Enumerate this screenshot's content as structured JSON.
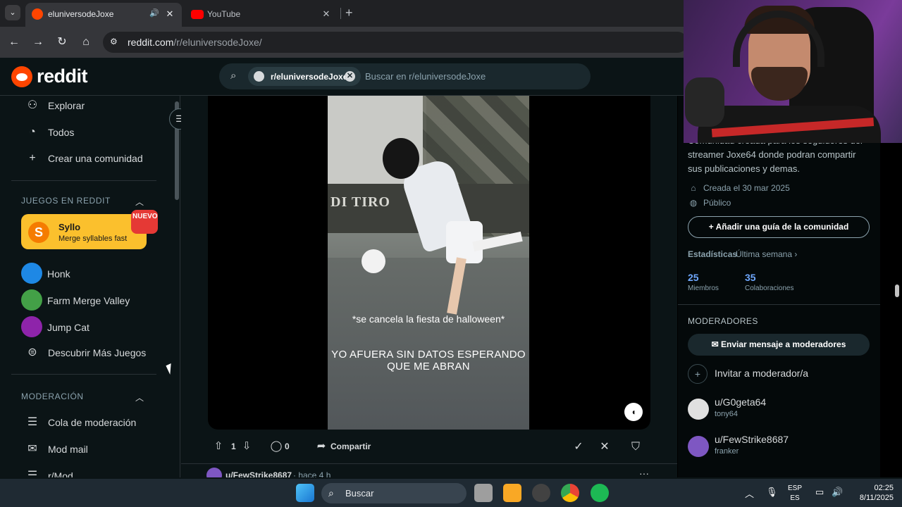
{
  "browser": {
    "tabs": [
      {
        "title": "eluniversodeJoxe",
        "active": true
      },
      {
        "title": "YouTube",
        "active": false
      }
    ],
    "url_host": "reddit.com",
    "url_path": "/r/eluniversodeJoxe/"
  },
  "reddit": {
    "logo_text": "reddit",
    "search": {
      "chip": "r/eluniversodeJoxe",
      "placeholder": "Buscar en r/eluniversodeJoxe"
    }
  },
  "sidebar": {
    "nav": [
      {
        "icon": "explore-icon",
        "label": "Explorar"
      },
      {
        "icon": "all-icon",
        "label": "Todos"
      },
      {
        "icon": "plus-icon",
        "label": "Crear una comunidad"
      }
    ],
    "games_title": "JUEGOS EN REDDIT",
    "featured_game": {
      "name": "Syllo",
      "subtitle": "Merge syllables fast",
      "badge": "NUEVO"
    },
    "games": [
      {
        "label": "Honk",
        "color": "#1e88e5"
      },
      {
        "label": "Farm Merge Valley",
        "color": "#43a047"
      },
      {
        "label": "Jump Cat",
        "color": "#8e24aa"
      }
    ],
    "more_games": "Descubrir Más Juegos",
    "moderation_title": "MODERACIÓN",
    "moderation": [
      {
        "label": "Cola de moderación"
      },
      {
        "label": "Mod mail"
      },
      {
        "label": "r/Mod"
      }
    ]
  },
  "post": {
    "caption_top": "*se cancela la fiesta de halloween*",
    "caption_bottom": "YO AFUERA SIN DATOS ESPERANDO QUE ME ABRAN",
    "banner_text": "DI TIRO",
    "votes": "1",
    "comments": "0",
    "share_label": "Compartir"
  },
  "next_post": {
    "user": "u/FewStrike8687",
    "time": "· hace 4 h"
  },
  "community": {
    "description": "Comunidad creada para los seguidores del streamer Joxe64 donde podran compartir sus publicaciones y demas.",
    "created": "Creada el 30 mar 2025",
    "visibility": "Público",
    "guide_button": "Añadir una guía de la comunidad",
    "stats_title": "Estadísticas",
    "stats_range": "Última semana ›",
    "stats": [
      {
        "value": "25",
        "label": "Miembros"
      },
      {
        "value": "35",
        "label": "Colaboraciones"
      }
    ],
    "moderators_title": "MODERADORES",
    "message_mods": "Enviar mensaje a moderadores",
    "invite_mod": "Invitar a moderador/a",
    "moderators": [
      {
        "name": "u/G0geta64",
        "flair": "tony64",
        "color": "#e0e0e0"
      },
      {
        "name": "u/FewStrike8687",
        "flair": "franker",
        "color": "#7e57c2"
      }
    ]
  },
  "taskbar": {
    "search_label": "Buscar",
    "lang_top": "ESP",
    "lang_bottom": "ES",
    "time": "02:25",
    "date": "8/11/2025"
  },
  "colors": {
    "reddit_orange": "#ff4500",
    "background": "#0b1416",
    "accent_blue": "#6fa8ff"
  }
}
